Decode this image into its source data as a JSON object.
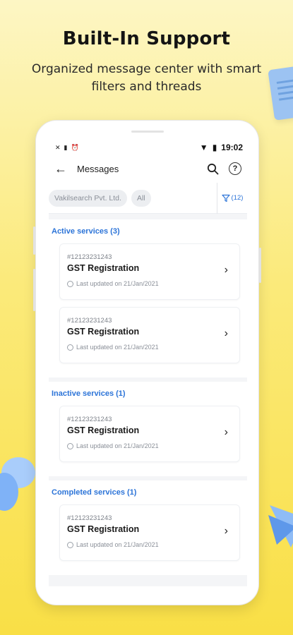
{
  "promo": {
    "headline": "Built-In Support",
    "subhead": "Organized message center with smart filters and threads"
  },
  "status_bar": {
    "time": "19:02",
    "left_icons": [
      "notification-icon",
      "sim-icon",
      "alarm-icon"
    ],
    "right_icons": [
      "wifi-icon",
      "battery-icon"
    ]
  },
  "app_bar": {
    "title": "Messages",
    "back_icon": "←",
    "help_icon": "?"
  },
  "filters": {
    "company_chip": "Vakilsearch Pvt. Ltd.",
    "status_chip": "All",
    "filter_count": "(12)"
  },
  "sections": {
    "active": {
      "label": "Active services (3)",
      "cards": [
        {
          "number": "#12123231243",
          "title": "GST Registration",
          "updated": "Last updated on 21/Jan/2021"
        },
        {
          "number": "#12123231243",
          "title": "GST Registration",
          "updated": "Last updated on 21/Jan/2021"
        }
      ]
    },
    "inactive": {
      "label": "Inactive services (1)",
      "cards": [
        {
          "number": "#12123231243",
          "title": "GST Registration",
          "updated": "Last updated on 21/Jan/2021"
        }
      ]
    },
    "completed": {
      "label": "Completed services (1)",
      "cards": [
        {
          "number": "#12123231243",
          "title": "GST Registration",
          "updated": "Last updated on 21/Jan/2021"
        }
      ]
    }
  },
  "colors": {
    "accent": "#2c74d8",
    "background_yellow": "#f9df46"
  }
}
